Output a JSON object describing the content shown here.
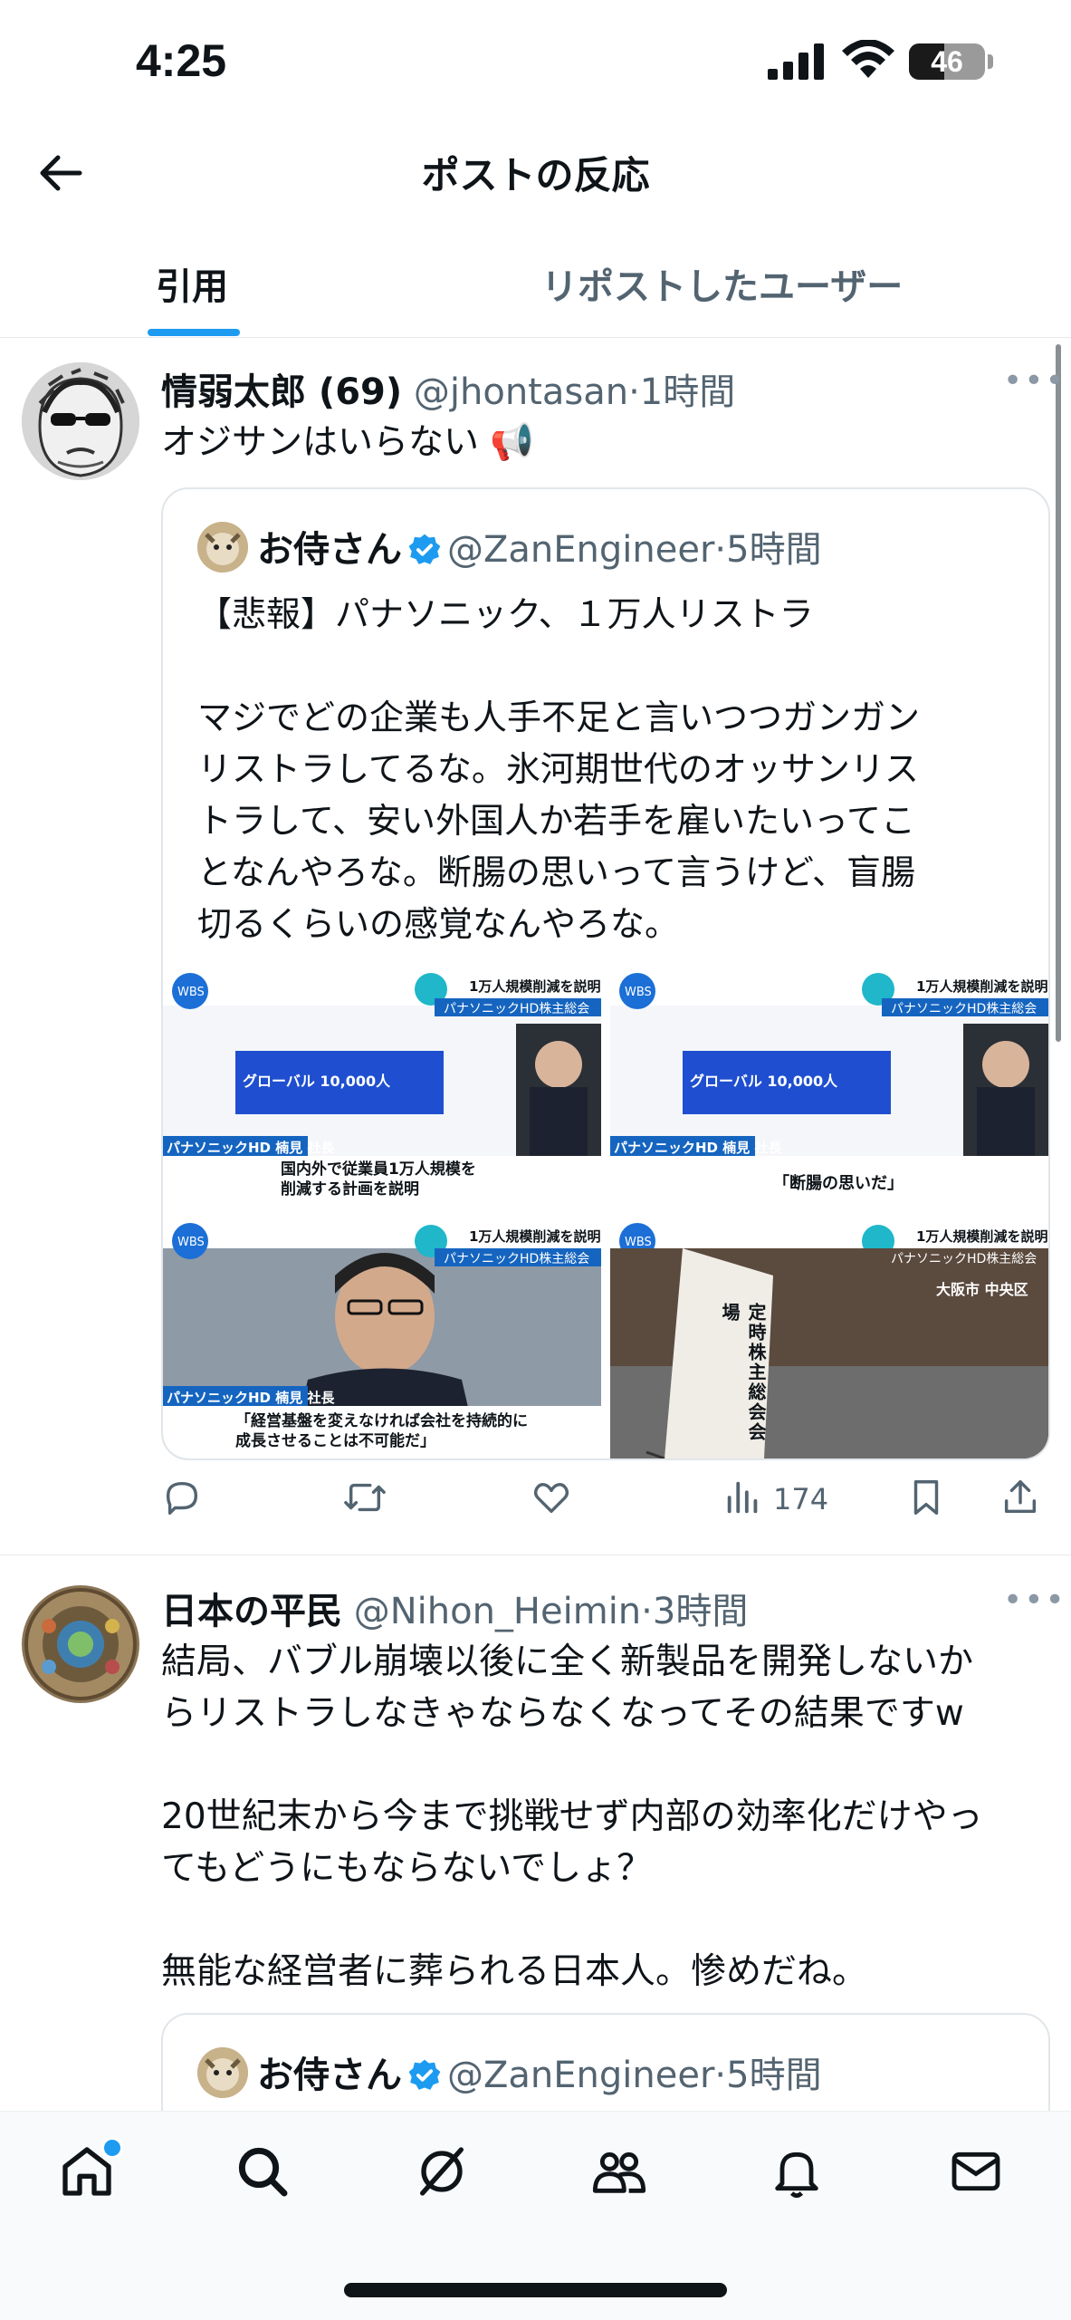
{
  "status_bar": {
    "time": "4:25",
    "battery": "46",
    "battery_level": 0.46
  },
  "header": {
    "title": "ポストの反応"
  },
  "tabs": [
    {
      "label": "引用"
    },
    {
      "label": "リポストしたユーザー"
    }
  ],
  "posts": [
    {
      "name": "情弱太郎 (69)",
      "handle": "@jhontasan",
      "time": "1時間",
      "text": "オジサンはいらない 📢",
      "quote": {
        "name": "お侍さん",
        "handle": "@ZanEngineer",
        "time": "5時間",
        "text": "【悲報】パナソニック、１万人リストラ\n\nマジでどの企業も人手不足と言いつつガンガン\nリストラしてるな。氷河期世代のオッサンリス\nトラして、安い外国人か若手を雇いたいってこ\nとなんやろな。断腸の思いって言うけど、盲腸\n切るくらいの感覚なんやろな。",
        "images": [
          {
            "tag": "1万人規模削減を説明",
            "sub": "パナソニックHD株主総会",
            "lower": "パナソニックHD 楠見 社長",
            "caption": "国内外で従業員1万人規模を\n削減する計画を説明",
            "box": "グローバル 10,000人"
          },
          {
            "tag": "1万人規模削減を説明",
            "sub": "パナソニックHD株主総会",
            "lower": "パナソニックHD 楠見 社長",
            "caption": "「断腸の思いだ」",
            "box": "グローバル 10,000人"
          },
          {
            "tag": "1万人規模削減を説明",
            "sub": "パナソニックHD株主総会",
            "lower": "パナソニックHD 楠見 社長",
            "caption": "「経営基盤を変えなければ会社を持続的に\n成長させることは不可能だ」"
          },
          {
            "tag": "1万人規模削減を説明",
            "sub": "パナソニックHD株主総会",
            "place": "大阪市 中央区",
            "sign": "定時株主総会会場"
          }
        ]
      },
      "views": "174"
    },
    {
      "name": "日本の平民",
      "handle": "@Nihon_Heimin",
      "time": "3時間",
      "text": "結局、バブル崩壊以後に全く新製品を開発しないか\nらリストラしなきゃならなくなってその結果ですw\n\n20世紀末から今まで挑戦せず内部の効率化だけやっ\nてもどうにもならないでしょ？\n\n無能な経営者に葬られる日本人。惨めだね。",
      "quote": {
        "name": "お侍さん",
        "handle": "@ZanEngineer",
        "time": "5時間"
      }
    }
  ],
  "nav": [
    "home-icon",
    "search-icon",
    "grok-icon",
    "communities-icon",
    "notifications-icon",
    "messages-icon"
  ]
}
